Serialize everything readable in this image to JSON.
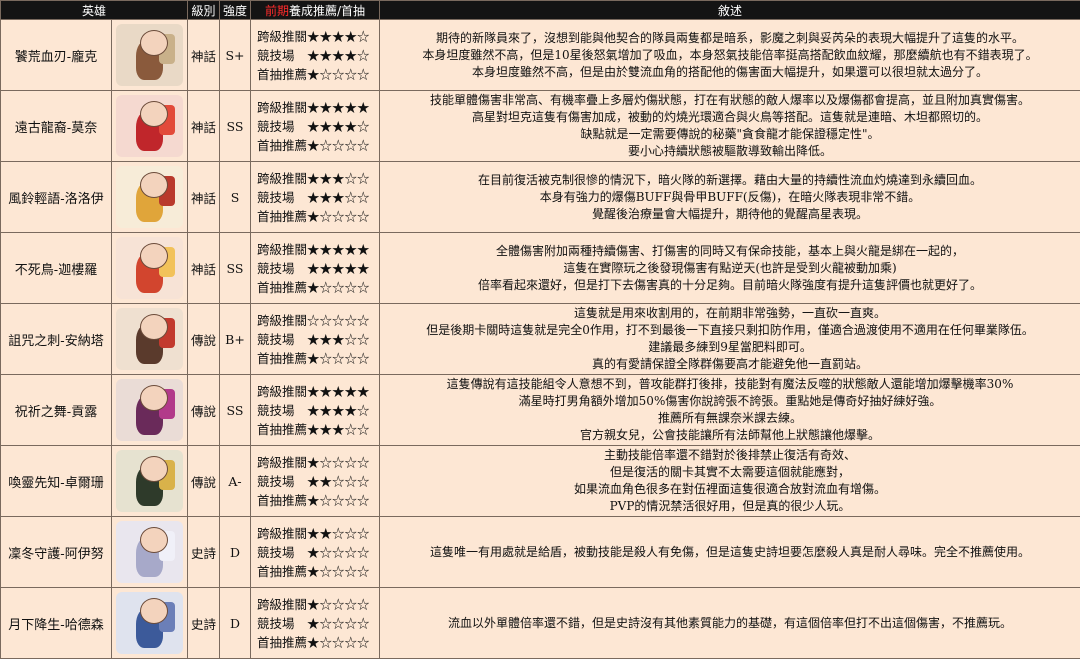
{
  "headers": {
    "hero": "英雄",
    "rarity": "級別",
    "grade": "強度",
    "recs_prefix": "前期",
    "recs_rest": "養成推薦/首抽",
    "desc": "敘述"
  },
  "rows": [
    {
      "name": "饕荒血刃-龐克",
      "rarity": "神話",
      "grade": "S+",
      "recs": [
        "跨級推關★★★★☆",
        "競技場　★★★★☆",
        "首抽推薦★☆☆☆☆"
      ],
      "desc": [
        "期待的新隊員來了，沒想到能與他契合的隊員兩隻都是暗系，影魔之刺與妥芮朵的表現大幅提升了這隻的水平。",
        "本身坦度雖然不高，但是10星後怒氣增加了吸血，本身怒氣技能倍率挺高搭配飲血紋耀，那麼續航也有不錯表現了。",
        "本身坦度雖然不高，但是由於雙流血角的搭配他的傷害面大幅提升，如果還可以很坦就太過分了。"
      ],
      "colors": {
        "bg": "#e9d9c6",
        "body": "#8a5a3c",
        "acc": "#c9b18a"
      }
    },
    {
      "name": "遠古龍裔-莫奈",
      "rarity": "神話",
      "grade": "SS",
      "recs": [
        "跨級推關★★★★★",
        "競技場　★★★★☆",
        "首抽推薦★☆☆☆☆"
      ],
      "desc": [
        "技能單體傷害非常高、有機率疊上多層灼傷狀態，打在有狀態的敵人爆率以及爆傷都會提高，並且附加真實傷害。",
        "高星對坦克這隻有傷害加成，被動的灼燒光環適合與火鳥等搭配。這隻就是連暗、木坦都照切的。",
        "缺點就是一定需要傳說的秘藥\"貪食龍才能保證穩定性\"。",
        "要小心持續狀態被驅散導致輸出降低。"
      ],
      "colors": {
        "bg": "#f5d9d0",
        "body": "#c0262b",
        "acc": "#e24a3a"
      }
    },
    {
      "name": "風鈴輕語-洛洛伊",
      "rarity": "神話",
      "grade": "S",
      "recs": [
        "跨級推關★★★☆☆",
        "競技場　★★★☆☆",
        "首抽推薦★☆☆☆☆"
      ],
      "desc": [
        "在目前復活被克制很慘的情況下，暗火隊的新選擇。藉由大量的持續性流血灼燒達到永續回血。",
        "本身有強力的爆傷BUFF與骨甲BUFF(反傷)，在暗火隊表現非常不錯。",
        "覺醒後治療量會大幅提升，期待他的覺醒高星表現。"
      ],
      "colors": {
        "bg": "#f7ecd8",
        "body": "#e0a53a",
        "acc": "#b93a2c"
      }
    },
    {
      "name": "不死鳥-迦樓羅",
      "rarity": "神話",
      "grade": "SS",
      "recs": [
        "跨級推關★★★★★",
        "競技場　★★★★★",
        "首抽推薦★☆☆☆☆"
      ],
      "desc": [
        "全體傷害附加兩種持續傷害、打傷害的同時又有保命技能，基本上與火龍是綁在一起的，",
        "這隻在實際玩之後發現傷害有點逆天(也許是受到火龍被動加乘)",
        "倍率看起來還好，但是打下去傷害真的十分足夠。目前暗火隊強度有提升這隻評價也就更好了。"
      ],
      "colors": {
        "bg": "#f7e3d6",
        "body": "#d2452e",
        "acc": "#f2c25a"
      }
    },
    {
      "name": "詛咒之刺-安納塔",
      "rarity": "傳說",
      "grade": "B+",
      "recs": [
        "跨級推關☆☆☆☆☆",
        "競技場　★★★☆☆",
        "首抽推薦★☆☆☆☆"
      ],
      "desc": [
        "這隻就是用來收割用的，在前期非常強勢，一直砍一直爽。",
        "但是後期卡關時這隻就是完全0作用，打不到最後一下直接只剩扣防作用，僅適合過渡使用不適用在任何畢業隊伍。",
        "建議最多練到9星當肥料即可。",
        "真的有愛請保證全隊群傷要高才能避免他一直罰站。"
      ],
      "colors": {
        "bg": "#efe0d0",
        "body": "#5a3a2c",
        "acc": "#c23a2e"
      }
    },
    {
      "name": "祝祈之舞-貢露",
      "rarity": "傳說",
      "grade": "SS",
      "recs": [
        "跨級推關★★★★★",
        "競技場　★★★★☆",
        "首抽推薦★★★☆☆"
      ],
      "desc": [
        "這隻傳說有這技能組令人意想不到，普攻能群打後排，技能對有魔法反噬的狀態敵人還能增加爆擊機率30%",
        "滿星時打男角額外增加50%傷害你說誇張不誇張。重點她是傳奇好抽好練好強。",
        "推薦所有無課奈米課去練。",
        "官方親女兒，公會技能讓所有法師幫他上狀態讓他爆擊。"
      ],
      "colors": {
        "bg": "#eadcd6",
        "body": "#6a2a5a",
        "acc": "#b23a8a"
      }
    },
    {
      "name": "喚靈先知-卓爾珊",
      "rarity": "傳說",
      "grade": "A-",
      "recs": [
        "跨級推關★☆☆☆☆",
        "競技場　★★☆☆☆",
        "首抽推薦★☆☆☆☆"
      ],
      "desc": [
        "主動技能倍率還不錯對於後排禁止復活有奇效、",
        "但是復活的關卡其實不太需要這個就能應對，",
        "如果流血角色很多在對伍裡面這隻很適合放對流血有增傷。",
        "PVP的情況禁活很好用，但是真的很少人玩。"
      ],
      "colors": {
        "bg": "#e6e2d0",
        "body": "#2e3a2a",
        "acc": "#d9b24a"
      }
    },
    {
      "name": "凜冬守護-阿伊努",
      "rarity": "史詩",
      "grade": "D",
      "recs": [
        "跨級推關★★☆☆☆",
        "競技場　★☆☆☆☆",
        "首抽推薦★☆☆☆☆"
      ],
      "desc": [
        "這隻唯一有用處就是給盾，被動技能是殺人有免傷，但是這隻史詩坦要怎麼殺人真是耐人尋味。完全不推薦使用。"
      ],
      "colors": {
        "bg": "#e9e6ee",
        "body": "#a7a9c9",
        "acc": "#f0f0f8"
      }
    },
    {
      "name": "月下降生-哈德森",
      "rarity": "史詩",
      "grade": "D",
      "recs": [
        "跨級推關★☆☆☆☆",
        "競技場　★☆☆☆☆",
        "首抽推薦★☆☆☆☆"
      ],
      "desc": [
        "流血以外單體倍率還不錯，但是史詩沒有其他素質能力的基礎，有這個倍率但打不出這個傷害，不推薦玩。"
      ],
      "colors": {
        "bg": "#dfe3ee",
        "body": "#3c5a9a",
        "acc": "#6b7fb8"
      }
    }
  ]
}
